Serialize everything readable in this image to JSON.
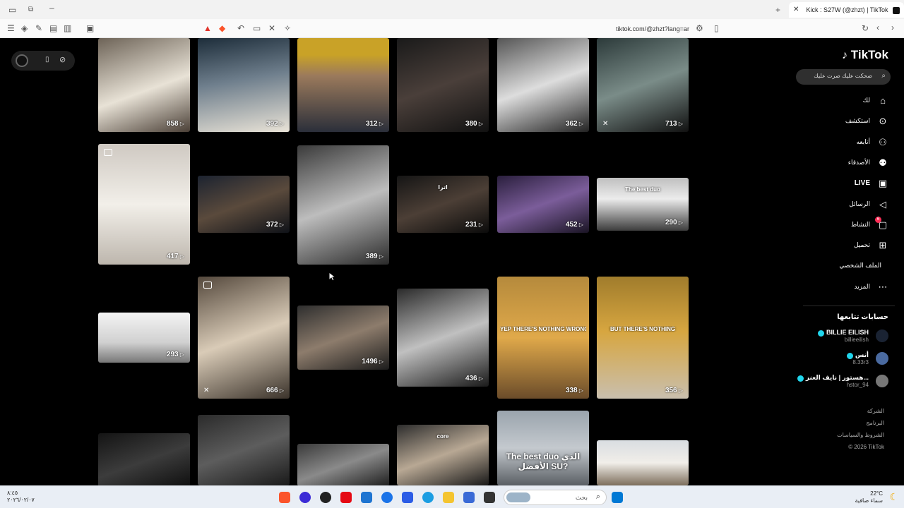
{
  "browser": {
    "tab_title": "Kick : S27W (@zhzt) | TikTok",
    "url": "tiktok.com/@zhzt?lang=ar"
  },
  "sidebar": {
    "logo": "TikTok",
    "search_placeholder": "ضحكت عليك صرت عليك",
    "nav": [
      {
        "label": "لك",
        "icon": "home-icon"
      },
      {
        "label": "استكشف",
        "icon": "explore-icon"
      },
      {
        "label": "أتابعه",
        "icon": "following-icon"
      },
      {
        "label": "الأصدقاء",
        "icon": "friends-icon"
      },
      {
        "label": "LIVE",
        "icon": "live-icon"
      },
      {
        "label": "الرسائل",
        "icon": "messages-icon"
      },
      {
        "label": "النشاط",
        "icon": "activity-icon",
        "badge": "6"
      },
      {
        "label": "تحميل",
        "icon": "upload-icon"
      },
      {
        "label": "الملف الشخصي",
        "icon": "profile-icon"
      },
      {
        "label": "المزيد",
        "icon": "more-icon"
      }
    ],
    "following_title": "حسابات تتابعها",
    "accounts": [
      {
        "name": "BILLIE EILISH",
        "handle": "billieeilish"
      },
      {
        "name": "أنس",
        "handle": "8.33r3"
      },
      {
        "name": "هستور | نايف العنز...",
        "handle": "hstor_94"
      }
    ],
    "footer": [
      "الشركة",
      "البرنامج",
      "الشروط والسياسات",
      "© 2026 TikTok"
    ]
  },
  "videos": [
    {
      "views": "858",
      "caption": ""
    },
    {
      "views": "392",
      "caption": ""
    },
    {
      "views": "312",
      "caption": ""
    },
    {
      "views": "380",
      "caption": ""
    },
    {
      "views": "362",
      "caption": ""
    },
    {
      "views": "713",
      "caption": ""
    },
    {
      "views": "417",
      "caption": ""
    },
    {
      "views": "372",
      "caption": ""
    },
    {
      "views": "389",
      "caption": ""
    },
    {
      "views": "231",
      "caption": "اترا"
    },
    {
      "views": "452",
      "caption": ""
    },
    {
      "views": "290",
      "caption": "The best duo"
    },
    {
      "views": "293",
      "caption": ""
    },
    {
      "views": "666",
      "caption": ""
    },
    {
      "views": "1496",
      "caption": ""
    },
    {
      "views": "436",
      "caption": ""
    },
    {
      "views": "338",
      "caption": "YEP THERE'S NOTHING WRONG WITH"
    },
    {
      "views": "356",
      "caption": "BUT THERE'S NOTHING"
    },
    {
      "views": "",
      "caption": ""
    },
    {
      "views": "",
      "caption": ""
    },
    {
      "views": "",
      "caption": ""
    },
    {
      "views": "",
      "caption": "core"
    },
    {
      "views": "",
      "caption": "The best duo الذي الأفضل SU?"
    },
    {
      "views": "",
      "caption": ""
    }
  ],
  "taskbar": {
    "search_placeholder": "بحث",
    "weather_temp": "22°C",
    "weather_desc": "سماء صافية",
    "time": "٨:٤٥",
    "date": "٢٠٢٦/٠٢/٠٧"
  },
  "colors": {
    "accent": "#fe2c55",
    "verified": "#20d5ec"
  }
}
